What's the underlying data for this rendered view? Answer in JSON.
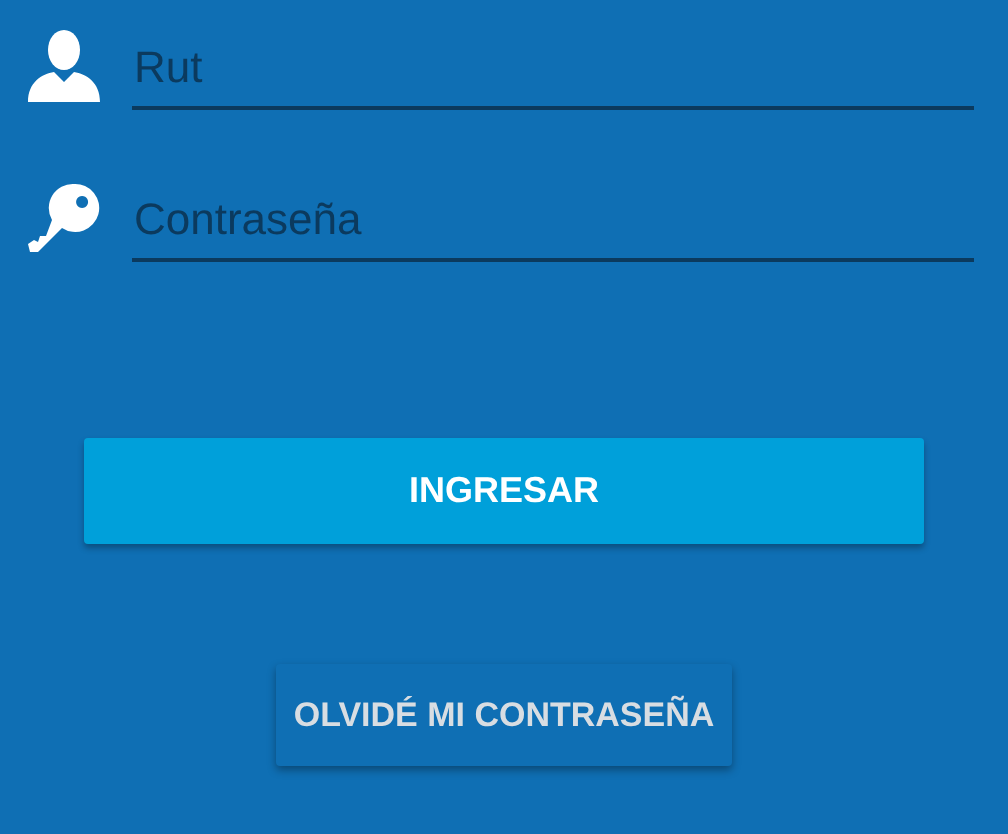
{
  "fields": [
    {
      "kind": "user",
      "placeholder": "Rut"
    },
    {
      "kind": "password",
      "placeholder": "Contraseña"
    }
  ],
  "login_button": {
    "label": "INGRESAR"
  },
  "forgot_button": {
    "label": "OLVIDÉ MI CONTRASEÑA"
  }
}
